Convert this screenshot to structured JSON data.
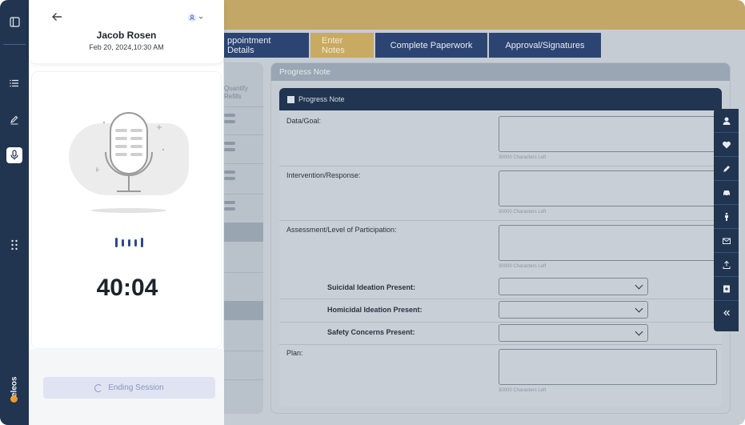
{
  "patient": {
    "name": "Jacob Rosen",
    "datetime": "Feb 20, 2024,10:30 AM"
  },
  "recording": {
    "timer": "40:04",
    "end_label": "Ending Session"
  },
  "tabs": [
    "ppointment Details",
    "Enter Notes",
    "Complete Paperwork",
    "Approval/Signatures"
  ],
  "left_column": {
    "header": "Quantify Refills"
  },
  "panel": {
    "title": "Progress Note",
    "card_title": "Progress Note"
  },
  "fields": {
    "data_goal": "Data/Goal:",
    "intervention": "Intervention/Response:",
    "assessment": "Assessment/Level of Participation:",
    "suicidal": "Suicidal Ideation Present:",
    "homicidal": "Homicidal Ideation Present:",
    "safety": "Safety Concerns Present:",
    "plan": "Plan:",
    "chars_left": "30000 Characters Left"
  },
  "brand": {
    "name": "eleos"
  },
  "colors": {
    "navy": "#213450",
    "gold": "#c2a767",
    "accent": "#2e4a86"
  },
  "icons": {
    "rail": [
      "collapse-sidebar-icon",
      "list-icon",
      "edit-icon",
      "microphone-icon",
      "grid-icon"
    ],
    "tools": [
      "person-icon",
      "heart-icon",
      "pen-icon",
      "car-icon",
      "figure-icon",
      "mail-icon",
      "upload-icon",
      "add-contact-icon",
      "double-chevron-left-icon"
    ]
  }
}
